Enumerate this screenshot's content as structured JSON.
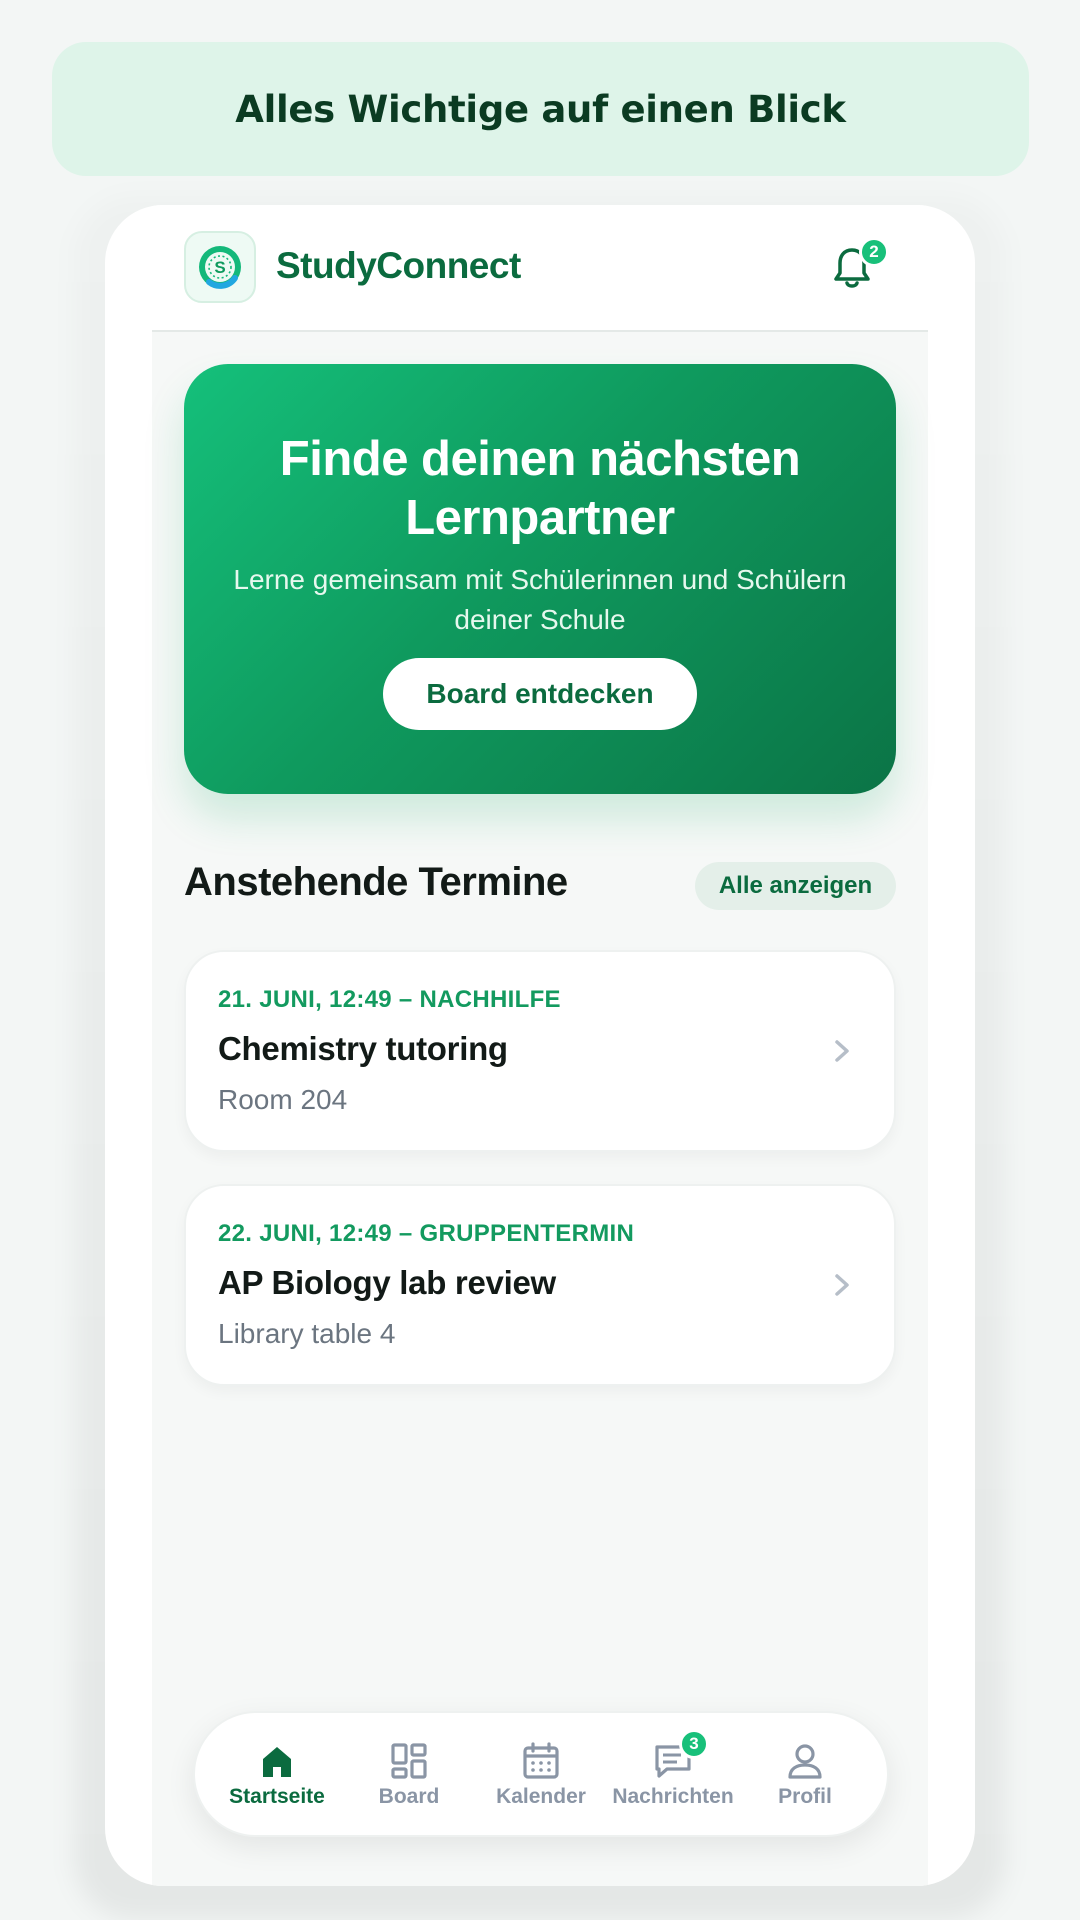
{
  "banner": {
    "title": "Alles Wichtige auf einen Blick"
  },
  "header": {
    "app_name": "StudyConnect",
    "logo_letter": "S",
    "notification_count": "2"
  },
  "hero": {
    "title": "Finde deinen nächsten Lernpartner",
    "subtitle": "Lerne gemeinsam mit Schülerinnen und Schülern deiner Schule",
    "button_label": "Board entdecken"
  },
  "upcoming": {
    "section_title": "Anstehende Termine",
    "show_all_label": "Alle anzeigen",
    "events": [
      {
        "meta": "21. JUNI, 12:49 – NACHHILFE",
        "title": "Chemistry tutoring",
        "location": "Room 204"
      },
      {
        "meta": "22. JUNI, 12:49 – GRUPPENTERMIN",
        "title": "AP Biology lab review",
        "location": "Library table 4"
      }
    ]
  },
  "nav": {
    "items": [
      {
        "label": "Startseite",
        "icon": "home-icon",
        "active": true
      },
      {
        "label": "Board",
        "icon": "grid-icon"
      },
      {
        "label": "Kalender",
        "icon": "calendar-icon"
      },
      {
        "label": "Nachrichten",
        "icon": "chat-icon",
        "badge": "3"
      },
      {
        "label": "Profil",
        "icon": "user-icon"
      }
    ]
  },
  "colors": {
    "brand": "#0b6b3f",
    "accent": "#18c07a",
    "banner_bg": "#def4e9",
    "inactive": "#8a95a5"
  }
}
